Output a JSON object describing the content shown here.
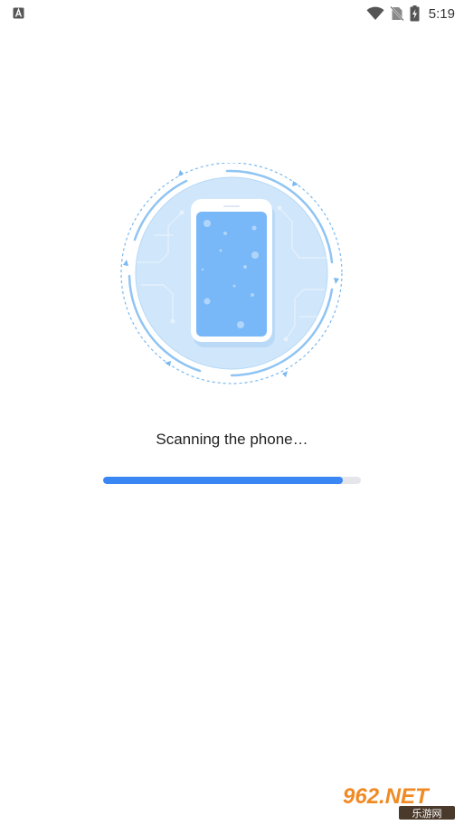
{
  "status_bar": {
    "notification_icon": "a-box-icon",
    "wifi_icon": "wifi-icon",
    "no_sim_icon": "no-sim-icon",
    "battery_icon": "battery-charging-icon",
    "time": "5:19"
  },
  "scan": {
    "status_text": "Scanning the phone…",
    "progress": 0.93
  },
  "watermark": {
    "brand": "962.NET",
    "subtitle": "乐游网"
  },
  "colors": {
    "accent": "#3a86f5",
    "track": "#e4e6ea",
    "circle_light": "#cfe6fb",
    "ring": "#8fc4f3",
    "phone_screen": "#79b8f8"
  }
}
